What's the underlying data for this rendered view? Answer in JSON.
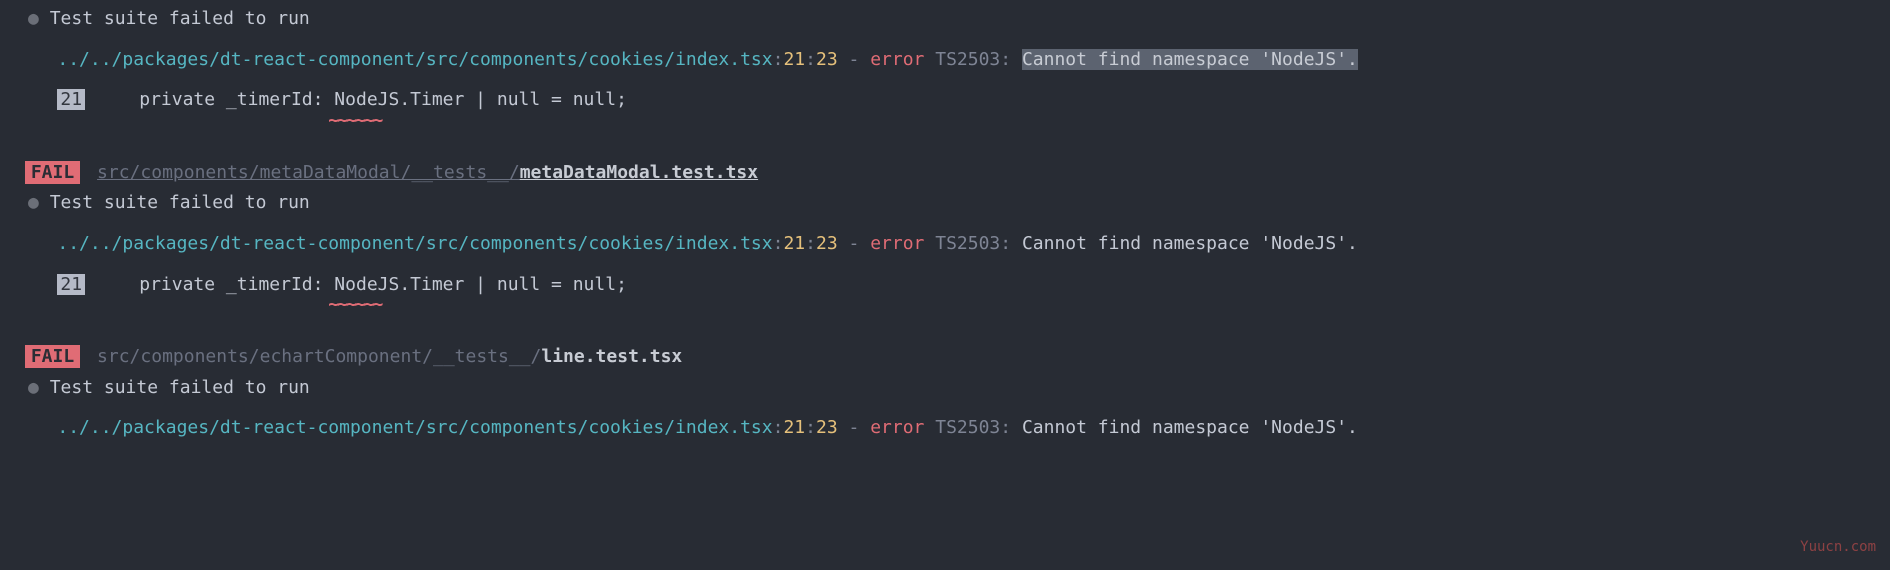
{
  "blocks": [
    {
      "suite_failed": "Test suite failed to run",
      "error_path": "../../packages/dt-react-component/src/components/cookies/index.tsx",
      "error_line": "21",
      "error_col": "23",
      "dash": "-",
      "error_word": "error",
      "error_code": "TS2503:",
      "error_msg": "Cannot find namespace 'NodeJS'.",
      "error_msg_highlighted": true,
      "code_line_num": "21",
      "code_line": "    private _timerId: NodeJS.Timer | null = null;",
      "squiggle_target": "NodeJS"
    },
    {
      "fail_badge": "FAIL",
      "test_path_dim": "src/components/metaDataModal/__tests__/",
      "test_path_file": "metaDataModal.test.tsx",
      "test_path_underline": true,
      "suite_failed": "Test suite failed to run",
      "error_path": "../../packages/dt-react-component/src/components/cookies/index.tsx",
      "error_line": "21",
      "error_col": "23",
      "dash": "-",
      "error_word": "error",
      "error_code": "TS2503:",
      "error_msg": "Cannot find namespace 'NodeJS'.",
      "error_msg_highlighted": false,
      "code_line_num": "21",
      "code_line": "    private _timerId: NodeJS.Timer | null = null;",
      "squiggle_target": "NodeJS"
    },
    {
      "fail_badge": "FAIL",
      "test_path_dim": "src/components/echartComponent/__tests__/",
      "test_path_file": "line.test.tsx",
      "test_path_underline": false,
      "suite_failed": "Test suite failed to run",
      "error_path": "../../packages/dt-react-component/src/components/cookies/index.tsx",
      "error_line": "21",
      "error_col": "23",
      "dash": "-",
      "error_word": "error",
      "error_code": "TS2503:",
      "error_msg": "Cannot find namespace 'NodeJS'.",
      "error_msg_highlighted": false
    }
  ],
  "watermark": "Yuucn.com"
}
